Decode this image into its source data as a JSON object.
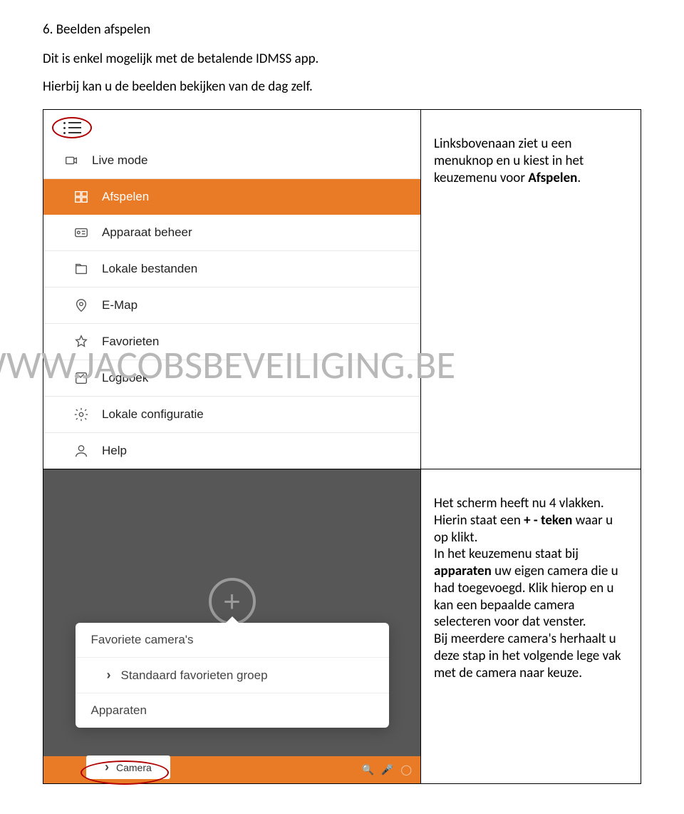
{
  "heading": "6.   Beelden afspelen",
  "intro1": "Dit is enkel mogelijk met de betalende IDMSS app.",
  "intro2": "Hierbij kan u de beelden bekijken van de dag zelf.",
  "watermark": "WWW.JACOBSBEVEILIGING.BE",
  "row1": {
    "desc_pre": "Linksbovenaan ziet u een menuknop en u kiest in het keuzemenu voor ",
    "desc_bold": "Afspelen",
    "desc_post": "."
  },
  "menu": {
    "items": [
      {
        "label": "Live mode",
        "selected": false
      },
      {
        "label": "Afspelen",
        "selected": true
      },
      {
        "label": "Apparaat beheer",
        "selected": false
      },
      {
        "label": "Lokale bestanden",
        "selected": false
      },
      {
        "label": "E-Map",
        "selected": false
      },
      {
        "label": "Favorieten",
        "selected": false
      },
      {
        "label": "Logboek",
        "selected": false
      },
      {
        "label": "Lokale configuratie",
        "selected": false
      },
      {
        "label": "Help",
        "selected": false
      }
    ]
  },
  "row2": {
    "l1": "Het scherm heeft nu 4 vlakken.",
    "l2a": "Hierin staat een ",
    "l2b": "+ - teken",
    "l2c": " waar u op klikt.",
    "l3a": "In het keuzemenu staat bij ",
    "l3b": "apparaten",
    "l3c": " uw eigen camera die u had toegevoegd. Klik hierop en u kan een bepaalde camera selecteren voor dat venster.",
    "l4": "Bij meerdere camera's herhaalt u deze stap in het volgende lege vak met de camera naar keuze."
  },
  "popup": {
    "fav": "Favoriete camera's",
    "group": "Standaard favorieten groep",
    "apparaten": "Apparaten",
    "camera": "Camera"
  }
}
